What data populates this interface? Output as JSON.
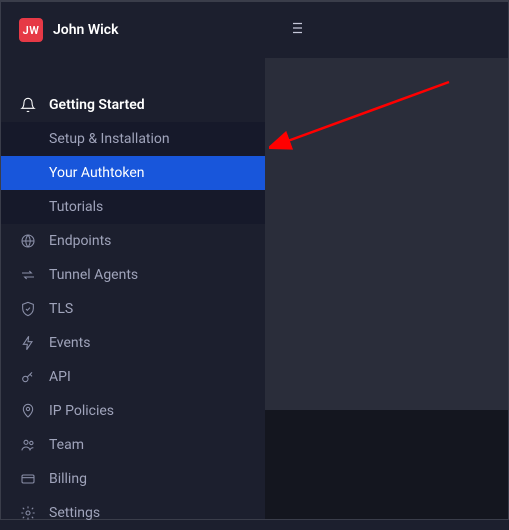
{
  "user": {
    "initials": "JW",
    "name": "John Wick"
  },
  "sidebar": {
    "getting_started": {
      "label": "Getting Started",
      "children": {
        "setup": "Setup & Installation",
        "authtoken": "Your Authtoken",
        "tutorials": "Tutorials"
      }
    },
    "items": {
      "endpoints": "Endpoints",
      "tunnel_agents": "Tunnel Agents",
      "tls": "TLS",
      "events": "Events",
      "api": "API",
      "ip_policies": "IP Policies",
      "team": "Team",
      "billing": "Billing",
      "settings": "Settings"
    }
  },
  "colors": {
    "accent": "#1856db",
    "avatar_bg": "#e63946",
    "annotation": "#ff0000"
  }
}
